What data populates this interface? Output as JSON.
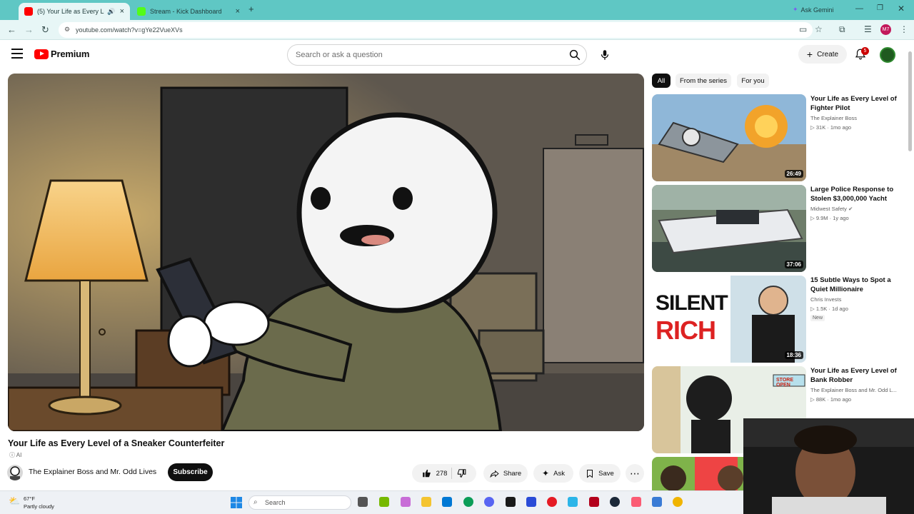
{
  "browser": {
    "tabs": [
      {
        "title": "(5) Your Life as Every Level o",
        "active": true
      },
      {
        "title": "Stream - Kick Dashboard",
        "active": false
      }
    ],
    "new_tab": "+",
    "url": "youtube.com/watch?v=gYe22VueXVs",
    "ask_gemini": "Ask Gemini"
  },
  "header": {
    "logo_text": "Premium",
    "search_placeholder": "Search or ask a question",
    "create_label": "Create",
    "notifications_count": "5"
  },
  "video": {
    "title": "Your Life as Every Level of a Sneaker Counterfeiter",
    "ai_tag": "AI",
    "channel": "The Explainer Boss and Mr. Odd Lives",
    "subscribe_label": "Subscribe",
    "likes": "278",
    "share_label": "Share",
    "ask_label": "Ask",
    "save_label": "Save"
  },
  "filters": [
    {
      "label": "All",
      "selected": true
    },
    {
      "label": "From the series",
      "selected": false
    },
    {
      "label": "For you",
      "selected": false
    }
  ],
  "recommendations": [
    {
      "title": "Your Life as Every Level of Fighter Pilot",
      "channel": "The Explainer Boss",
      "meta": "31K · 1mo ago",
      "duration": "26:49",
      "badge": ""
    },
    {
      "title": "Large Police Response to Stolen $3,000,000 Yacht",
      "channel": "Midwest Safety",
      "meta": "9.9M · 1y ago",
      "duration": "37:06",
      "badge": ""
    },
    {
      "title": "15 Subtle Ways to Spot a Quiet Millionaire",
      "channel": "Chris Invests",
      "meta": "1.5K · 1d ago",
      "duration": "18:36",
      "badge": "New",
      "thumb_text_1": "SILENT",
      "thumb_text_2": "RICH"
    },
    {
      "title": "Your Life as Every Level of Bank Robber",
      "channel": "The Explainer Boss and Mr. Odd L...",
      "meta": "88K · 1mo ago",
      "duration": "",
      "badge": "",
      "thumb_sign": "STORE OPEN"
    }
  ],
  "taskbar": {
    "weather_temp": "67°F",
    "weather_condition": "Partly cloudy",
    "search_label": "Search"
  },
  "colors": {
    "youtube_red": "#ff0000",
    "browser_frame": "#5fc7c4",
    "subscribe_bg": "#0f0f0f"
  }
}
